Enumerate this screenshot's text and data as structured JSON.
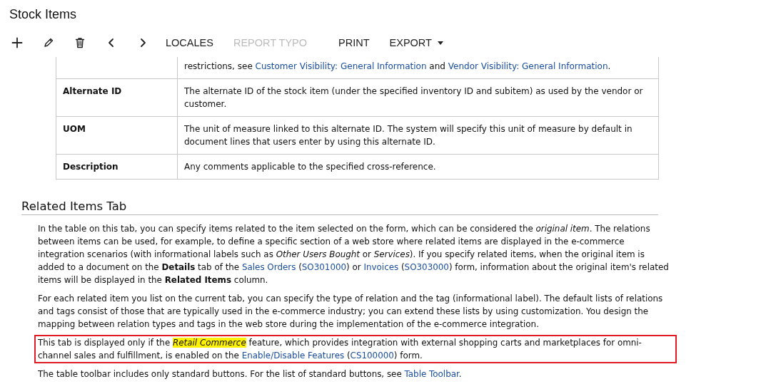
{
  "page": {
    "title": "Stock Items"
  },
  "toolbar": {
    "icon_buttons": [
      {
        "kind": "add"
      },
      {
        "kind": "edit"
      },
      {
        "kind": "delete"
      },
      {
        "kind": "previous"
      },
      {
        "kind": "next"
      }
    ],
    "buttons": [
      {
        "label": "LOCALES",
        "disabled": false,
        "dropdown": false
      },
      {
        "label": "REPORT TYPO",
        "disabled": true,
        "dropdown": false
      },
      {
        "label": "PRINT",
        "disabled": false,
        "dropdown": false
      },
      {
        "label": "EXPORT",
        "disabled": false,
        "dropdown": true
      }
    ]
  },
  "table": {
    "rows": [
      {
        "name": "",
        "description": [
          [
            {
              "kind": "text",
              "text": "restrictions, see "
            },
            {
              "kind": "link",
              "text": "Customer Visibility: General Information"
            },
            {
              "kind": "text",
              "text": " and "
            },
            {
              "kind": "link",
              "text": "Vendor Visibility: General Information"
            },
            {
              "kind": "text",
              "text": "."
            }
          ]
        ]
      },
      {
        "name": "Alternate ID",
        "description": [
          [
            {
              "kind": "text",
              "text": "The alternate ID of the stock item (under the specified inventory ID and subitem) as used by the vendor or customer."
            }
          ]
        ]
      },
      {
        "name": "UOM",
        "description": [
          [
            {
              "kind": "text",
              "text": "The unit of measure linked to this alternate ID. The system will specify this unit of measure by default in document lines that users enter by using this alternate ID."
            }
          ]
        ]
      },
      {
        "name": "Description",
        "description": [
          [
            {
              "kind": "text",
              "text": "Any comments applicable to the specified cross-reference."
            }
          ]
        ]
      }
    ]
  },
  "section": {
    "heading": "Related Items Tab",
    "paragraphs": [
      {
        "boxed": false,
        "segments": [
          {
            "kind": "text",
            "text": "In the table on this tab, you can specify items related to the item selected on the form, which can be considered the *original item*. The relations between items can be used, for example, to define a specific section of a web store where related items are displayed in the e-commerce integration scenarios (with informational labels such as *Other Users Bought* or *Services*). If you specify related items, when the original item is added to a document on the **Details** tab of the "
          },
          {
            "kind": "link",
            "text": "Sales Orders"
          },
          {
            "kind": "text",
            "text": " ("
          },
          {
            "kind": "link",
            "text": "SO301000"
          },
          {
            "kind": "text",
            "text": ") or "
          },
          {
            "kind": "link",
            "text": "Invoices"
          },
          {
            "kind": "text",
            "text": " ("
          },
          {
            "kind": "link",
            "text": "SO303000"
          },
          {
            "kind": "text",
            "text": ") form, information about the original item's related items will be displayed in the **Related Items** column."
          }
        ]
      },
      {
        "boxed": false,
        "segments": [
          {
            "kind": "text",
            "text": "For each related item you list on the current tab, you can specify the type of relation and the tag (informational label). The default lists of relations and tags consist of those that are typically used in the e-commerce industry; you can extend these lists by using customization. You design the mapping between relation types and tags in the web store during the implementation of the e-commerce integration."
          }
        ]
      },
      {
        "boxed": true,
        "segments": [
          {
            "kind": "text",
            "text": "This tab is displayed only if the "
          },
          {
            "kind": "highlight",
            "text": "Retail Commerce"
          },
          {
            "kind": "text",
            "text": " feature, which provides integration with external shopping carts and marketplaces for omni-channel sales and fulfillment, is enabled on the "
          },
          {
            "kind": "link",
            "text": "Enable/Disable Features"
          },
          {
            "kind": "text",
            "text": " ("
          },
          {
            "kind": "link",
            "text": "CS100000"
          },
          {
            "kind": "text",
            "text": ") form."
          }
        ]
      },
      {
        "boxed": false,
        "segments": [
          {
            "kind": "text",
            "text": "The table toolbar includes only standard buttons. For the list of standard buttons, see "
          },
          {
            "kind": "link",
            "text": "Table Toolbar"
          },
          {
            "kind": "text",
            "text": "."
          }
        ]
      }
    ]
  }
}
